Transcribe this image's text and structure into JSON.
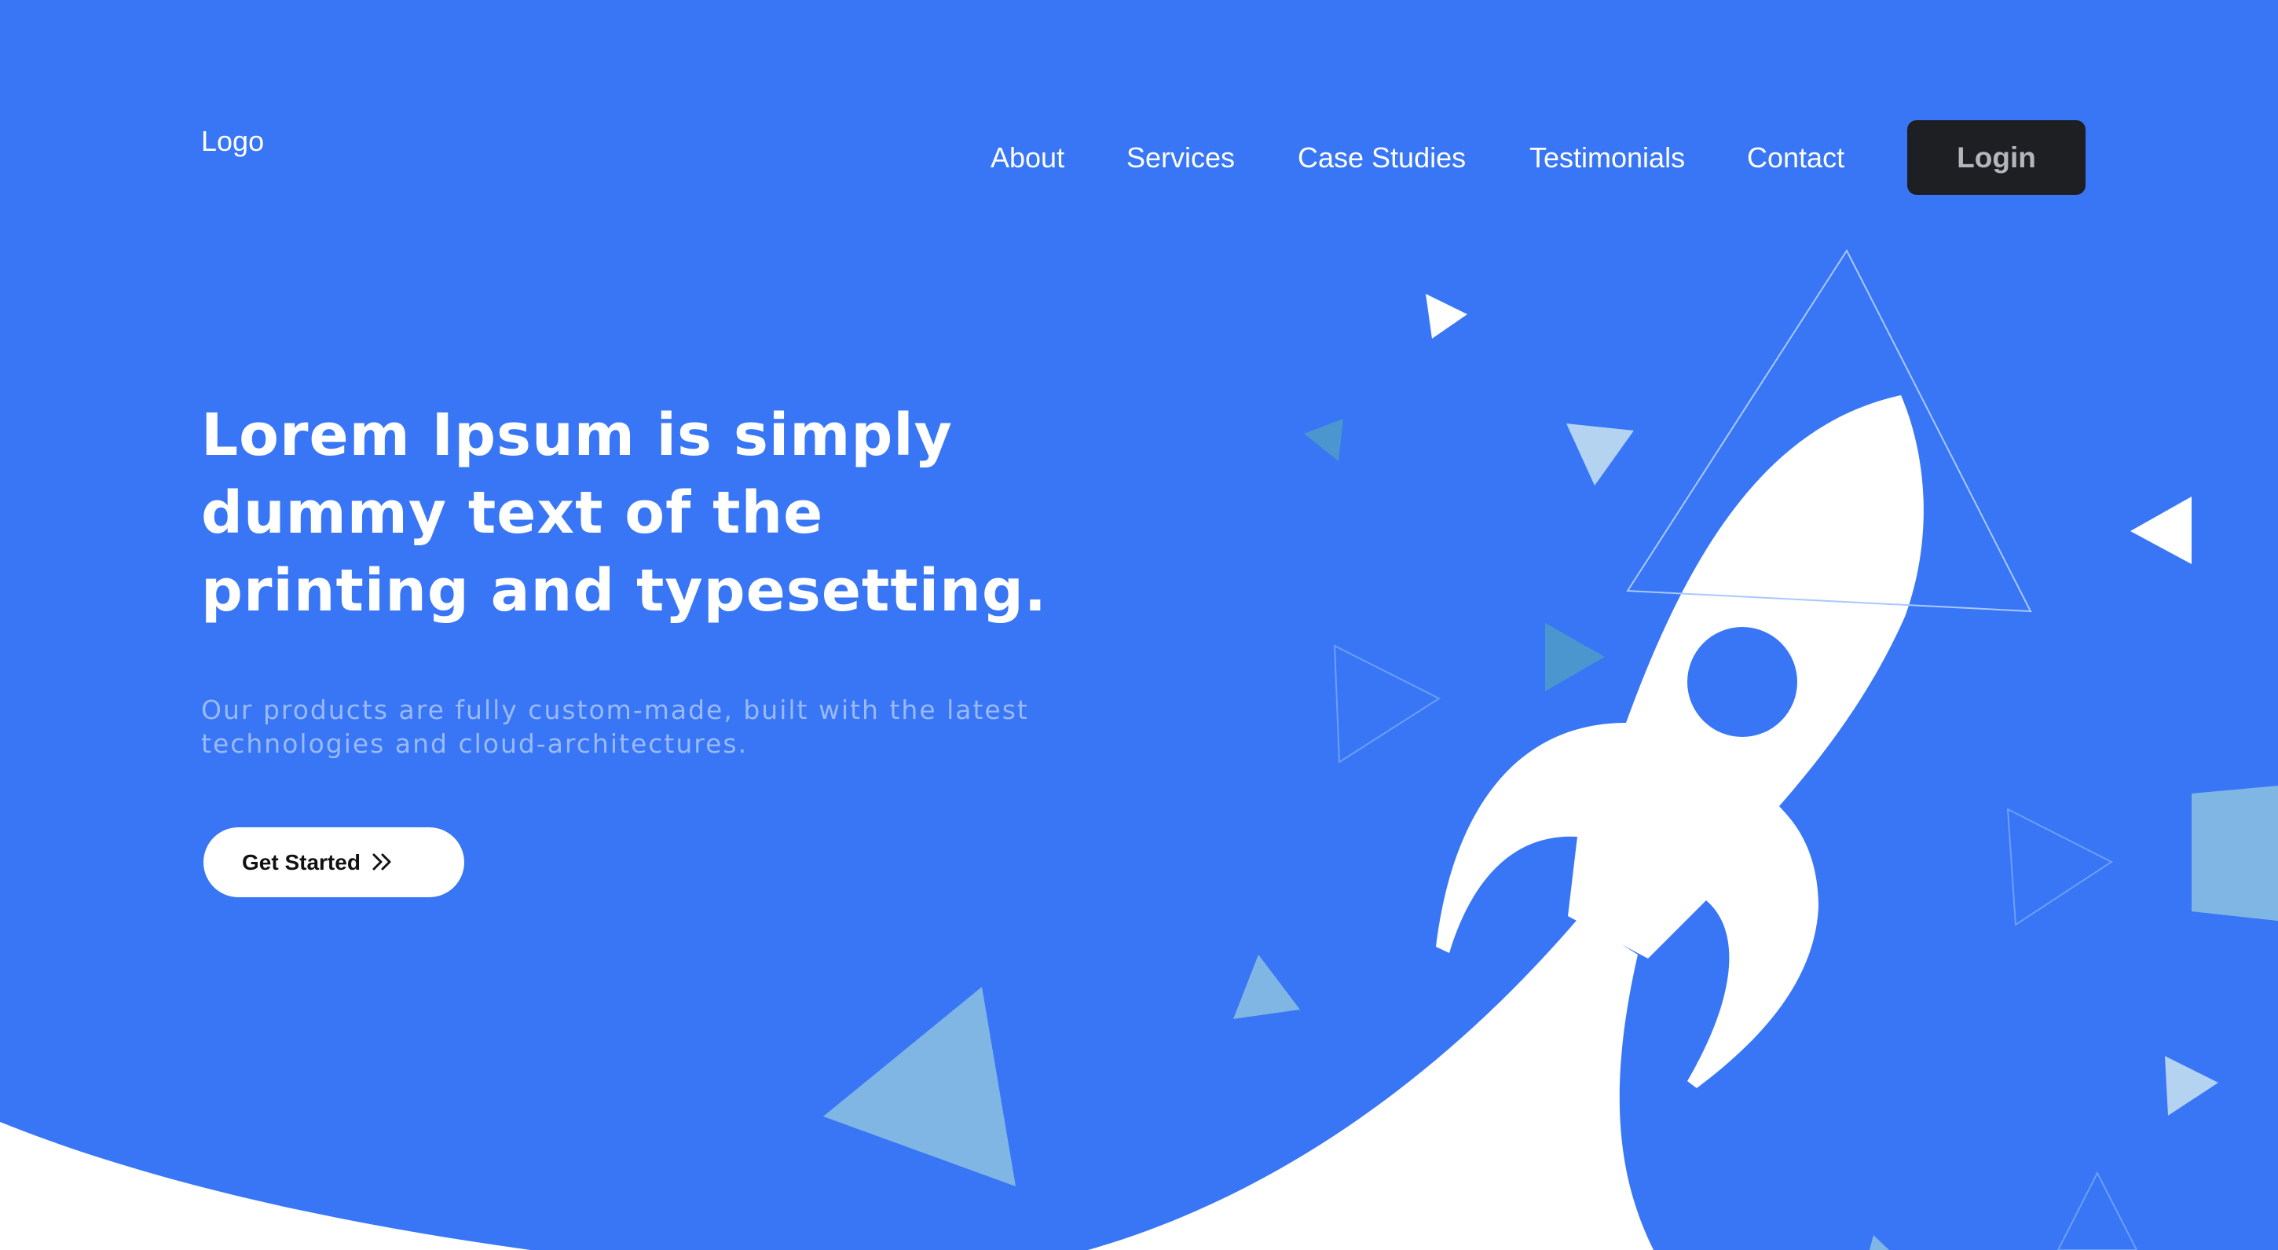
{
  "header": {
    "logo": "Logo",
    "nav": [
      "About",
      "Services",
      "Case Studies",
      "Testimonials",
      "Contact"
    ],
    "login_label": "Login"
  },
  "hero": {
    "headline_lines": [
      "Lorem Ipsum is simply",
      "dummy text of the",
      "printing and typesetting."
    ],
    "subtext_lines": [
      "Our products are fully custom-made, built with the latest",
      "technologies and cloud-architectures."
    ],
    "cta_label": "Get Started",
    "cta_icon": "double-chevron-right-icon"
  },
  "colors": {
    "background": "#3876f5",
    "login_bg": "#1e1f22",
    "login_text": "#b4b6bb",
    "subtext": "#9ab9f7",
    "light_triangle": "#80b6e3",
    "mid_triangle": "#4b96cf"
  }
}
